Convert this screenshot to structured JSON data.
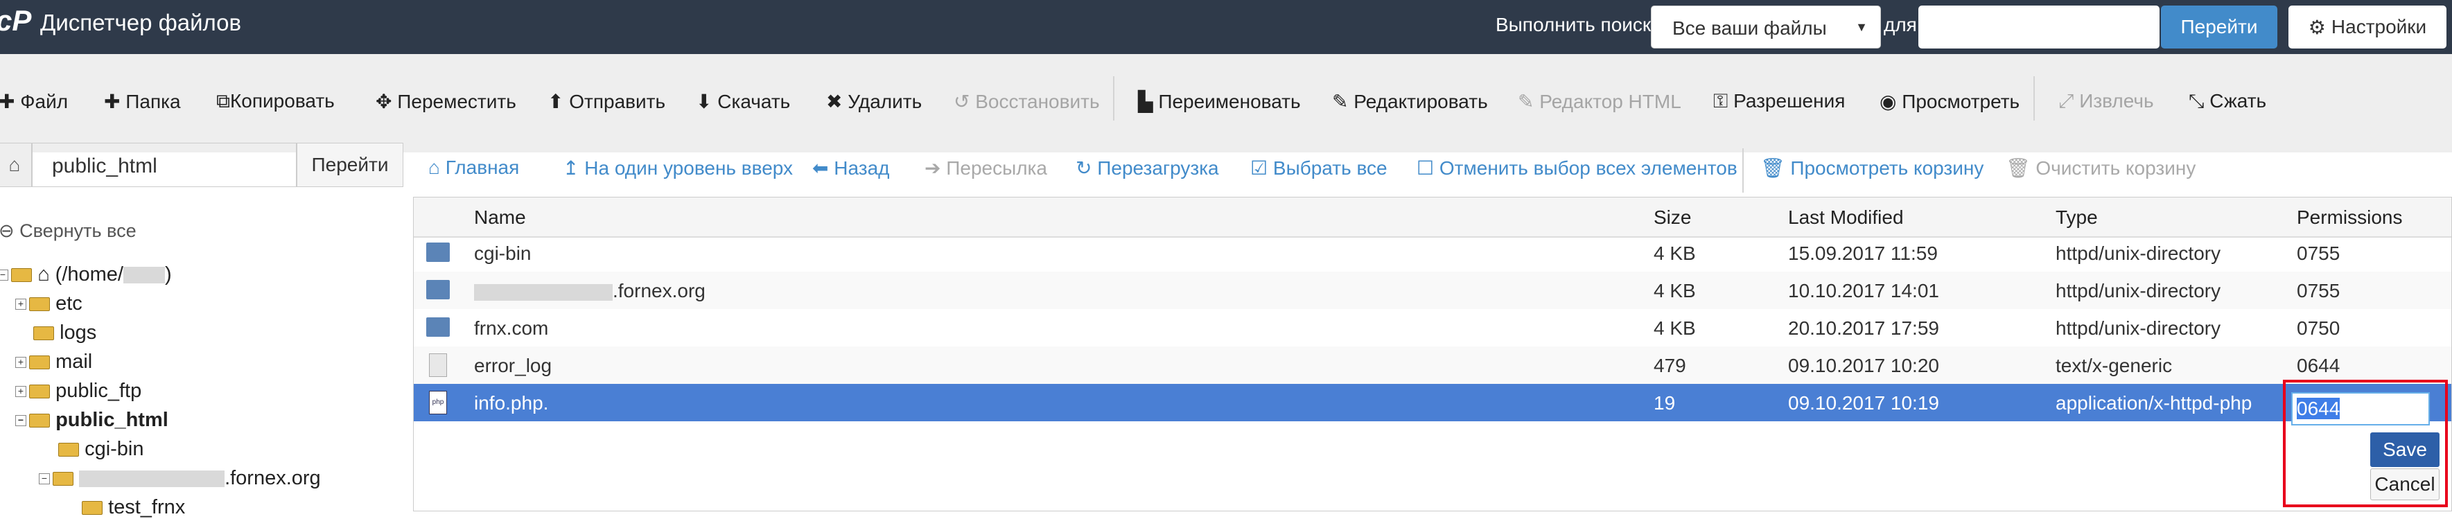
{
  "header": {
    "logo": "cP",
    "title": "Диспетчер файлов",
    "search_label": "Выполнить поиск",
    "scope_value": "Все ваши файлы",
    "for_label": "для",
    "search_value": "",
    "go_label": "Перейти",
    "settings_label": "Настройки"
  },
  "toolbar": {
    "file": "Файл",
    "folder": "Папка",
    "copy": "Копировать",
    "move": "Переместить",
    "upload": "Отправить",
    "download": "Скачать",
    "delete": "Удалить",
    "restore": "Восстановить",
    "rename": "Переименовать",
    "edit": "Редактировать",
    "html_editor": "Редактор HTML",
    "permissions": "Разрешения",
    "view": "Просмотреть",
    "extract": "Извлечь",
    "compress": "Сжать"
  },
  "path_bar": {
    "path": "public_html",
    "go_label": "Перейти"
  },
  "nav": {
    "home": "Главная",
    "up": "На один уровень вверх",
    "back": "Назад",
    "forward": "Пересылка",
    "reload": "Перезагрузка",
    "select_all": "Выбрать все",
    "unselect_all": "Отменить выбор всех элементов",
    "view_trash": "Просмотреть корзину",
    "empty_trash": "Очистить корзину"
  },
  "tree": {
    "collapse": "Свернуть все",
    "root_prefix": "(/home/",
    "root_suffix": ")",
    "items": [
      "etc",
      "logs",
      "mail",
      "public_ftp",
      "public_html",
      "cgi-bin",
      ".fornex.org",
      "test_frnx"
    ]
  },
  "table": {
    "columns": [
      "Name",
      "Size",
      "Last Modified",
      "Type",
      "Permissions"
    ],
    "rows": [
      {
        "name": "cgi-bin",
        "size": "4 KB",
        "modified": "15.09.2017 11:59",
        "type": "httpd/unix-directory",
        "perms": "0755"
      },
      {
        "name": ".fornex.org",
        "size": "4 KB",
        "modified": "10.10.2017 14:01",
        "type": "httpd/unix-directory",
        "perms": "0755"
      },
      {
        "name": "frnx.com",
        "size": "4 KB",
        "modified": "20.10.2017 17:59",
        "type": "httpd/unix-directory",
        "perms": "0750"
      },
      {
        "name": "error_log",
        "size": "479",
        "modified": "09.10.2017 10:20",
        "type": "text/x-generic",
        "perms": "0644"
      },
      {
        "name": "info.php.",
        "size": "19",
        "modified": "09.10.2017 10:19",
        "type": "application/x-httpd-php",
        "perms": ""
      }
    ]
  },
  "perm_editor": {
    "value": "0644",
    "save_label": "Save",
    "cancel_label": "Cancel"
  },
  "colors": {
    "topbar": "#2f3a4a",
    "accent": "#428bca",
    "selected_row": "#4a7fd4",
    "highlight_border": "#e8001c"
  }
}
